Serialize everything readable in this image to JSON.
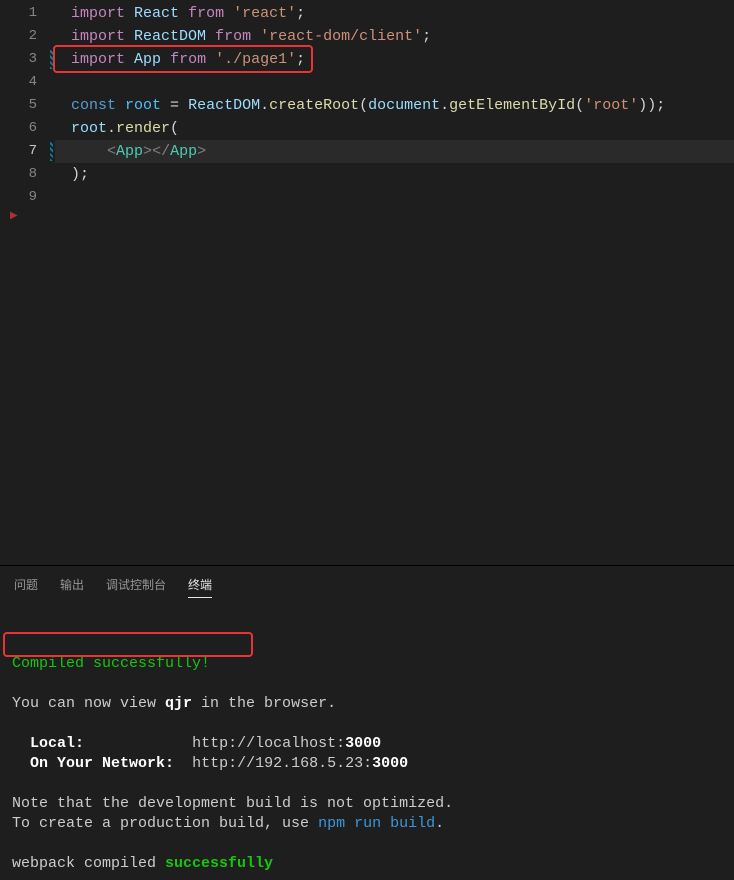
{
  "editor": {
    "lineNumbers": [
      "1",
      "2",
      "3",
      "4",
      "5",
      "6",
      "7",
      "8",
      "9"
    ],
    "tokens": {
      "import": "import",
      "from": "from",
      "const": "const",
      "React": "React",
      "ReactDOM": "ReactDOM",
      "AppT": "App",
      "sReact": "'react'",
      "sReactDom": "'react-dom/client'",
      "sPage1": "'./page1'",
      "root": "root",
      "eq": " = ",
      "dot": ".",
      "semi": ";",
      "comma": ",",
      "pO": "(",
      "pC": ")",
      "createRoot": "createRoot",
      "document": "document",
      "getById": "getElementById",
      "sRoot": "'root'",
      "render": "render",
      "open": "<",
      "close": ">",
      "closeSlash": "</",
      "AppTag": "App"
    }
  },
  "panel": {
    "tabs": {
      "problems": "问题",
      "output": "输出",
      "debug": "调试控制台",
      "terminal": "终端"
    },
    "term": {
      "compiled": "Compiled successfully!",
      "viewPrefix": "You can now view ",
      "app": "qjr",
      "viewSuffix": " in the browser.",
      "localLabel": "Local:",
      "localPad": "            ",
      "localUrlA": "http://localhost:",
      "localPort": "3000",
      "netLabel": "On Your Network:",
      "netPad": "  ",
      "netUrlA": "http://192.168.5.23:",
      "netPort": "3000",
      "note1": "Note that the development build is not optimized.",
      "note2a": "To create a production build, use ",
      "note2cmd": "npm run build",
      "note2b": ".",
      "wpA": "webpack compiled ",
      "wpB": "successfully"
    }
  }
}
